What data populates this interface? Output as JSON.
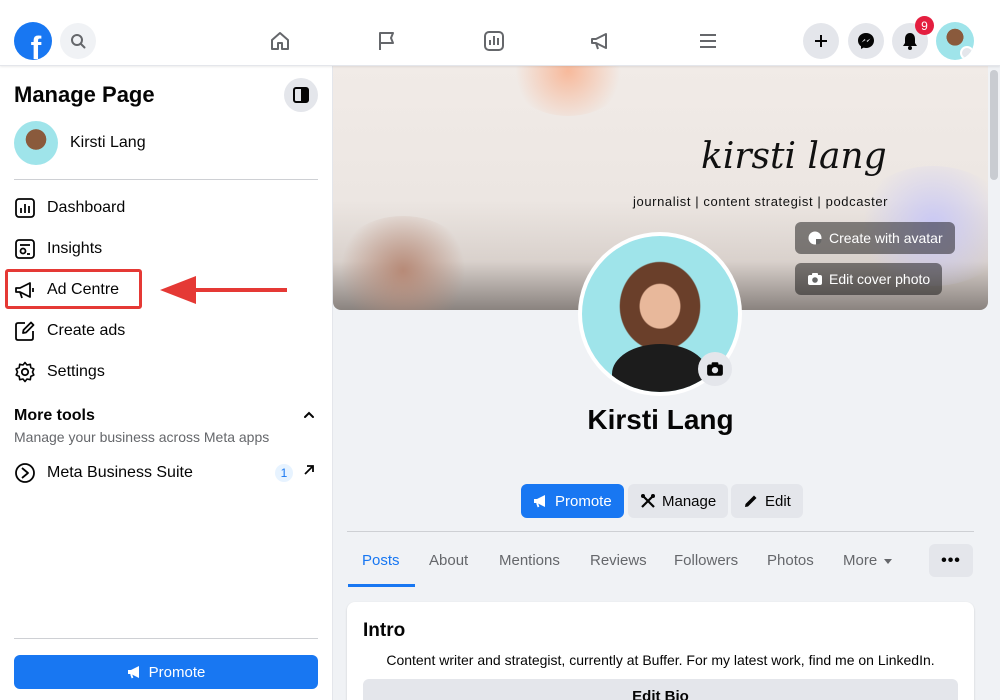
{
  "topnav": {
    "notification_count": "9",
    "logo_letter": "f"
  },
  "sidebar": {
    "title": "Manage Page",
    "profile_name": "Kirsti Lang",
    "items": [
      {
        "label": "Dashboard",
        "icon": "dashboard-icon"
      },
      {
        "label": "Insights",
        "icon": "insights-icon"
      },
      {
        "label": "Ad Centre",
        "icon": "megaphone-icon"
      },
      {
        "label": "Create ads",
        "icon": "edit-square-icon"
      },
      {
        "label": "Settings",
        "icon": "gear-icon"
      }
    ],
    "more_tools": {
      "title": "More tools",
      "subtitle": "Manage your business across Meta apps"
    },
    "meta_business_suite": {
      "label": "Meta Business Suite",
      "count": "1"
    },
    "promote_label": "Promote"
  },
  "cover": {
    "script_name": "kirsti lang",
    "tagline": "journalist | content strategist | podcaster",
    "create_avatar_label": "Create with avatar",
    "edit_cover_label": "Edit cover photo"
  },
  "profile": {
    "name": "Kirsti Lang",
    "buttons": {
      "promote": "Promote",
      "manage": "Manage",
      "edit": "Edit"
    }
  },
  "tabs": [
    {
      "label": "Posts",
      "active": true
    },
    {
      "label": "About"
    },
    {
      "label": "Mentions"
    },
    {
      "label": "Reviews"
    },
    {
      "label": "Followers"
    },
    {
      "label": "Photos"
    },
    {
      "label": "More"
    }
  ],
  "more_menu_label": "•••",
  "intro": {
    "title": "Intro",
    "text": "Content writer and strategist, currently at Buffer. For my latest work, find me on LinkedIn.",
    "edit_bio_label": "Edit Bio"
  },
  "colors": {
    "accent": "#1877f2",
    "highlight": "#e53935",
    "badge": "#e41e3f"
  }
}
